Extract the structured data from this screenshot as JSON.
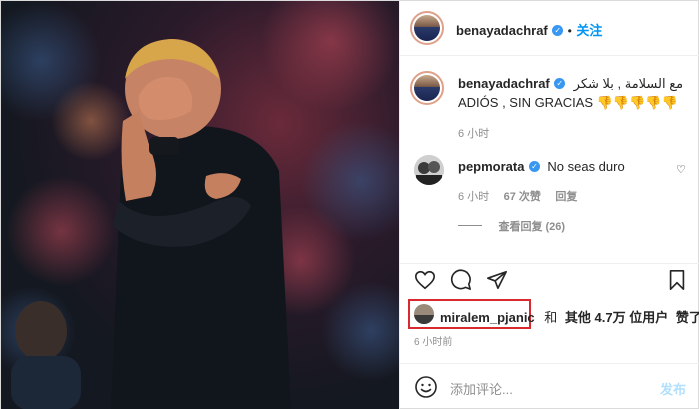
{
  "author": {
    "username": "benayadachraf",
    "separator": "•",
    "follow_label": "关注"
  },
  "caption": {
    "username": "benayadachraf",
    "line1": "مع السلامة , بلا شكر",
    "line2": "ADIÓS , SIN GRACIAS 👎👎👎👎👎",
    "time": "6 小时"
  },
  "reply_comment": {
    "username": "pepmorata",
    "text": "No seas duro",
    "time": "6 小时",
    "likes": "67 次赞",
    "reply_label": "回复",
    "view_replies": "查看回复 (26)"
  },
  "likes": {
    "first_user": "miralem_pjanic",
    "connector": "和",
    "others": "其他 4.7万 位用户",
    "suffix": "赞了",
    "time": "6 小时前"
  },
  "composer": {
    "placeholder": "添加评论...",
    "post_label": "发布"
  },
  "colors": {
    "link_blue": "#0095f6",
    "verified_blue": "#3897f0",
    "highlight_red": "#d9292f",
    "post_disabled": "#b2dffc"
  }
}
